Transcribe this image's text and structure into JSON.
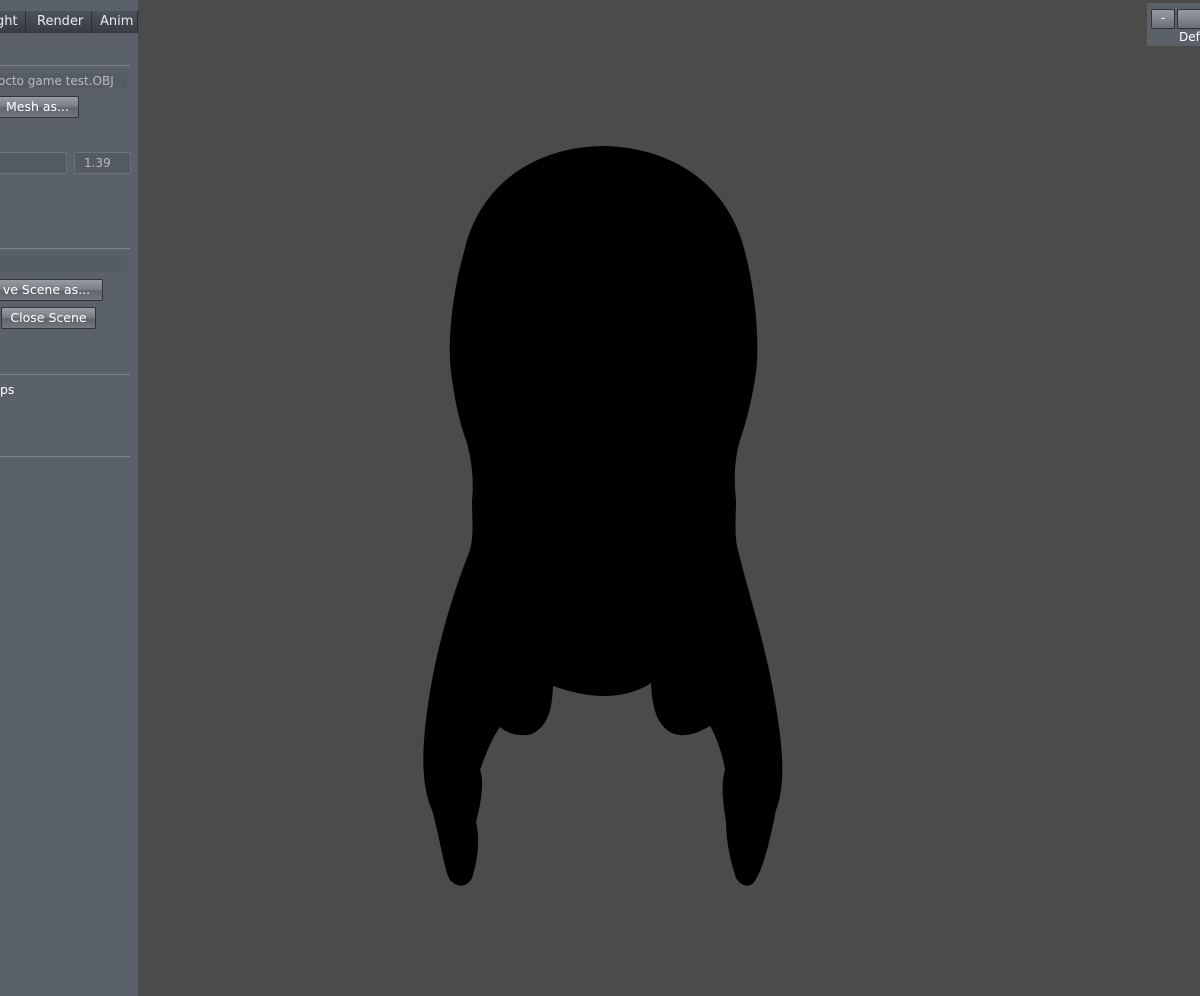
{
  "menu": {
    "tabs": [
      "ght",
      "Render",
      "Anim"
    ]
  },
  "mesh": {
    "filename": "octo game test.OBJ",
    "export_button": "Mesh as..."
  },
  "scale": {
    "slider_value": "",
    "value": "1.39"
  },
  "scene": {
    "filename": "",
    "save_button": "ve Scene as...",
    "close_button": "Close Scene"
  },
  "options": {
    "partial_label": "ps"
  },
  "top_right": {
    "minus_label": "-",
    "default_label": "Def"
  },
  "colors": {
    "panel": "#5a6169",
    "viewport": "#4b4b4b",
    "model": "#000000"
  }
}
